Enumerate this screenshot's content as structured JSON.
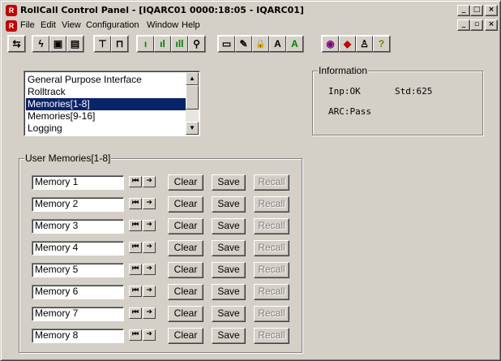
{
  "window": {
    "title": "RollCall Control Panel - [IQARC01 0000:18:05 - IQARC01]",
    "app_icon_glyph": "R",
    "caption_buttons": {
      "minimize": "_",
      "maximize": "□",
      "close": "×"
    },
    "mdi_buttons": {
      "minimize": "_",
      "restore": "▫",
      "close": "×"
    }
  },
  "menu": {
    "items": [
      "File",
      "Edit",
      "View",
      "Configuration",
      "Window",
      "Help"
    ]
  },
  "toolbar": {
    "icons": [
      "connect-icon",
      "lightning-icon",
      "save-icon",
      "save-all-icon",
      "network-icon",
      "network-single-icon",
      "signal-low-icon",
      "signal-med-icon",
      "signal-high-icon",
      "search-icon",
      "panel-icon",
      "edit-panel-icon",
      "lock-icon",
      "font-a-icon",
      "font-a-green-icon",
      "globe-icon",
      "diamond-icon",
      "user-icon",
      "help-icon"
    ],
    "glyphs": {
      "connect": "⇆",
      "lightning": "ϟ",
      "save": "▣",
      "save_all": "▤",
      "network": "⊤",
      "network_single": "⊓",
      "signal_low": "ı",
      "signal_med": "ıl",
      "signal_high": "ıll",
      "search": "⚲",
      "panel": "▭",
      "edit_panel": "✎",
      "lock": "🔒",
      "font_a": "A",
      "font_a_green": "A",
      "globe": "◉",
      "diamond": "◆",
      "user": "♙",
      "help": "?"
    }
  },
  "list": {
    "items": [
      "General Purpose Interface",
      "Rolltrack",
      "Memories[1-8]",
      "Memories[9-16]",
      "Logging"
    ],
    "selected_index": 2
  },
  "information": {
    "title": "Information",
    "inp": "Inp:OK",
    "std": "Std:625",
    "arc": "ARC:Pass"
  },
  "memories": {
    "title": "User Memories[1-8]",
    "clear_label": "Clear",
    "save_label": "Save",
    "recall_label": "Recall",
    "nav_glyphs": {
      "first": "⏮",
      "next": "➜"
    },
    "rows": [
      {
        "name": "Memory 1"
      },
      {
        "name": "Memory 2"
      },
      {
        "name": "Memory 3"
      },
      {
        "name": "Memory 4"
      },
      {
        "name": "Memory 5"
      },
      {
        "name": "Memory 6"
      },
      {
        "name": "Memory 7"
      },
      {
        "name": "Memory 8"
      }
    ]
  }
}
